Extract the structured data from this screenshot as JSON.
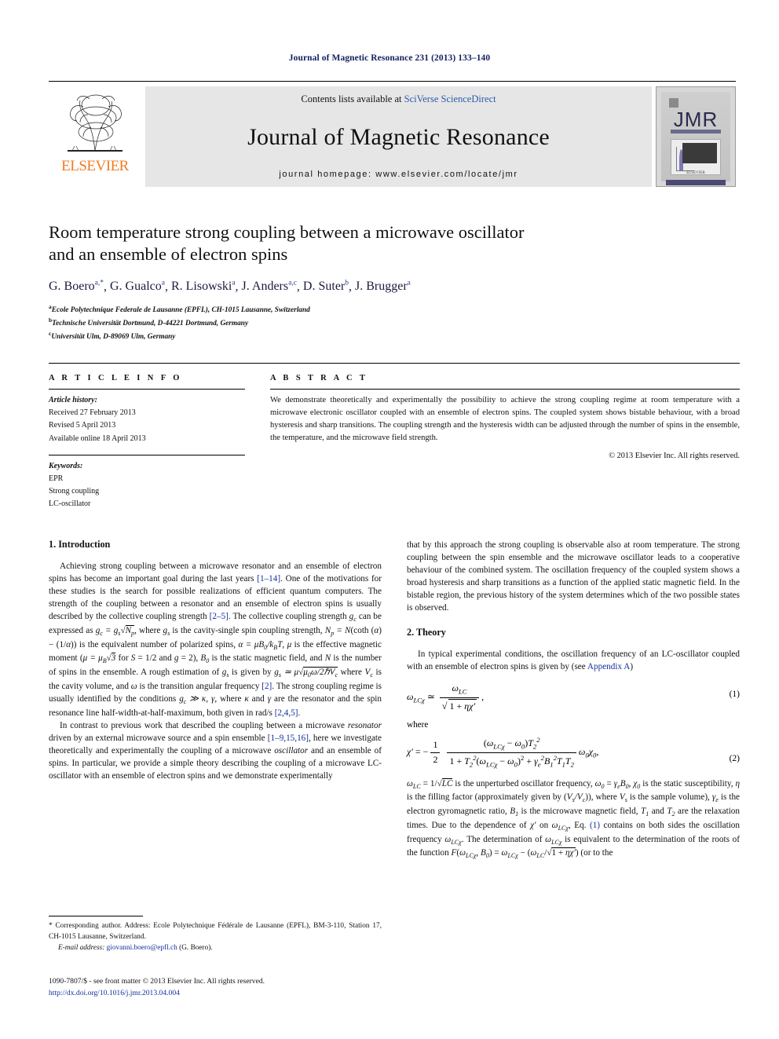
{
  "running_head": "Journal of Magnetic Resonance 231 (2013) 133–140",
  "masthead": {
    "publisher": "ELSEVIER",
    "contents_prefix": "Contents lists available at ",
    "contents_link": "SciVerse ScienceDirect",
    "journal_title": "Journal of Magnetic Resonance",
    "homepage": "journal homepage: www.elsevier.com/locate/jmr",
    "cover_title": "JMR",
    "cover_subtitle": "Journal of Magnetic Resonance",
    "cover_footer": "ELSEVIER"
  },
  "article": {
    "title_line1": "Room temperature strong coupling between a microwave oscillator",
    "title_line2": "and an ensemble of electron spins",
    "authors": [
      {
        "name": "G. Boero",
        "marks": "a,*"
      },
      {
        "name": "G. Gualco",
        "marks": "a"
      },
      {
        "name": "R. Lisowski",
        "marks": "a"
      },
      {
        "name": "J. Anders",
        "marks": "a,c"
      },
      {
        "name": "D. Suter",
        "marks": "b"
      },
      {
        "name": "J. Brugger",
        "marks": "a"
      }
    ],
    "affiliations": [
      {
        "mark": "a",
        "text": "Ecole Polytechnique Federale de Lausanne (EPFL), CH-1015 Lausanne, Switzerland"
      },
      {
        "mark": "b",
        "text": "Technische Universität Dortmund, D-44221 Dortmund, Germany"
      },
      {
        "mark": "c",
        "text": "Universität Ulm, D-89069 Ulm, Germany"
      }
    ]
  },
  "info": {
    "heading": "A R T I C L E   I N F O",
    "history_label": "Article history:",
    "history": [
      "Received 27 February 2013",
      "Revised 5 April 2013",
      "Available online 18 April 2013"
    ],
    "keywords_label": "Keywords:",
    "keywords": [
      "EPR",
      "Strong coupling",
      "LC-oscillator"
    ]
  },
  "abstract": {
    "heading": "A B S T R A C T",
    "text": "We demonstrate theoretically and experimentally the possibility to achieve the strong coupling regime at room temperature with a microwave electronic oscillator coupled with an ensemble of electron spins. The coupled system shows bistable behaviour, with a broad hysteresis and sharp transitions. The coupling strength and the hysteresis width can be adjusted through the number of spins in the ensemble, the temperature, and the microwave field strength.",
    "copyright": "© 2013 Elsevier Inc. All rights reserved."
  },
  "sections": {
    "intro_heading": "1. Introduction",
    "theory_heading": "2. Theory",
    "intro_p1_a": "Achieving strong coupling between a microwave resonator and an ensemble of electron spins has become an important goal during the last years ",
    "intro_p1_cite1": "[1–14]",
    "intro_p1_b": ". One of the motivations for these studies is the search for possible realizations of efficient quantum computers. The strength of the coupling between a resonator and an ensemble of electron spins is usually described by the collective coupling strength ",
    "intro_p1_cite2": "[2–5]",
    "intro_p1_c": ". The collective coupling strength ",
    "intro_p1_d": " can be expressed as ",
    "intro_p1_e": ", where ",
    "intro_p1_f": " is the cavity-single spin coupling strength, ",
    "intro_p1_g": " is the equivalent number of polarized spins, ",
    "intro_p1_h": " is the effective magnetic moment (",
    "intro_p1_i": "), ",
    "intro_p1_j": " is the static magnetic field, and ",
    "intro_p1_k": " is the number of spins in the ensemble. A rough estimation of ",
    "intro_p1_l": " is given by ",
    "intro_p1_m": " where ",
    "intro_p1_n": " is the cavity volume, and ",
    "intro_p1_o": " is the transition angular frequency ",
    "intro_p1_cite3": "[2]",
    "intro_p1_p": ". The strong coupling regime is usually identified by the conditions ",
    "intro_p1_q": ", where ",
    "intro_p1_r": " and ",
    "intro_p1_s": " are the resonator and the spin resonance line half-width-at-half-maximum, both given in rad/s ",
    "intro_p1_cite4": "[2,4,5]",
    "intro_p1_t": ".",
    "intro_p2_a": "In contrast to previous work that described the coupling between a microwave ",
    "intro_p2_res": "resonator",
    "intro_p2_b": " driven by an external microwave source and a spin ensemble ",
    "intro_p2_cite": "[1–9,15,16]",
    "intro_p2_c": ", here we investigate theoretically and experimentally the coupling of a microwave ",
    "intro_p2_osc": "oscillator",
    "intro_p2_d": " and an ensemble of spins. In particular, we provide a simple theory describing the coupling of a microwave LC-oscillator with an ensemble of electron spins and we demonstrate experimentally",
    "right_p1": "that by this approach the strong coupling is observable also at room temperature. The strong coupling between the spin ensemble and the microwave oscillator leads to a cooperative behaviour of the combined system. The oscillation frequency of the coupled system shows a broad hysteresis and sharp transitions as a function of the applied static magnetic field. In the bistable region, the previous history of the system determines which of the two possible states is observed.",
    "theory_p1_a": "In typical experimental conditions, the oscillation frequency of an LC-oscillator coupled with an ensemble of electron spins is given by (see ",
    "theory_p1_link": "Appendix A",
    "theory_p1_b": ")",
    "eq1_number": "(1)",
    "eq2_number": "(2)",
    "where_label": "where",
    "theory_p2_a": " is the unperturbed oscillator frequency, ",
    "theory_p2_b": " is the static susceptibility, ",
    "theory_p2_c": " is the filling factor (approximately given by (",
    "theory_p2_d": "), where ",
    "theory_p2_e": " is the sample volume), ",
    "theory_p2_f": " is the electron gyromagnetic ratio, ",
    "theory_p2_g": " is the microwave magnetic field, ",
    "theory_p2_h": " and ",
    "theory_p2_i": " are the relaxation times. Due to the dependence of ",
    "theory_p2_j": " on ",
    "theory_p2_k": ", Eq. ",
    "theory_p2_cite": "(1)",
    "theory_p2_l": " contains on both sides the oscillation frequency ",
    "theory_p2_m": ". The determination of ",
    "theory_p2_n": " is equivalent to the determination of the roots of the function ",
    "theory_p2_o": " (or to the"
  },
  "footnotes": {
    "corresponding": "* Corresponding author. Address: Ecole Polytechnique Fédérale de Lausanne (EPFL), BM-3-110, Station 17, CH-1015 Lausanne, Switzerland.",
    "email_label": "E-mail address:",
    "email": "giovanni.boero@epfl.ch",
    "email_suffix": "(G. Boero)."
  },
  "issn": {
    "line1": "1090-7807/$ - see front matter © 2013 Elsevier Inc. All rights reserved.",
    "doi": "http://dx.doi.org/10.1016/j.jmr.2013.04.004"
  },
  "colors": {
    "link": "#14309c",
    "running_head": "#14205e",
    "elsevier_orange": "#f07c23",
    "band_gray": "#e6e6e6"
  }
}
